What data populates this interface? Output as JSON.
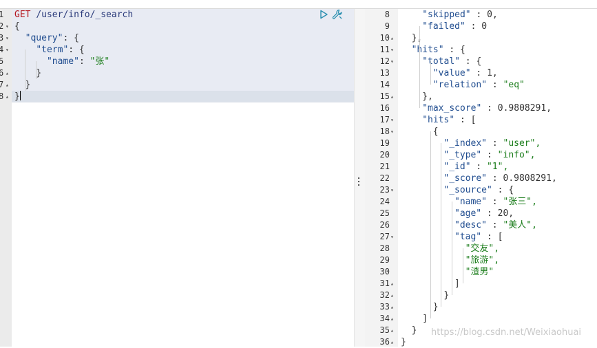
{
  "request_editor": {
    "line_numbers": [
      "1",
      "2",
      "3",
      "4",
      "5",
      "6",
      "7",
      "8"
    ],
    "method": "GET",
    "path": "/user/info/_search",
    "lines": {
      "l2": "{",
      "l3_key": "\"query\"",
      "l3_rest": ": {",
      "l4_key": "\"term\"",
      "l4_rest": ": {",
      "l5_key": "\"name\"",
      "l5_sep": ": ",
      "l5_val": "\"张\"",
      "l6": "}",
      "l7": "}",
      "l8": "}"
    }
  },
  "response_viewer": {
    "lines": [
      {
        "n": "8",
        "t": "\"skipped\" : 0,"
      },
      {
        "n": "9",
        "t": "\"failed\" : 0"
      },
      {
        "n": "10",
        "t": "},"
      },
      {
        "n": "11",
        "t": "\"hits\" : {"
      },
      {
        "n": "12",
        "t": "\"total\" : {"
      },
      {
        "n": "13",
        "t": "\"value\" : 1,"
      },
      {
        "n": "14",
        "t": "\"relation\" : \"eq\""
      },
      {
        "n": "15",
        "t": "},"
      },
      {
        "n": "16",
        "t": "\"max_score\" : 0.9808291,"
      },
      {
        "n": "17",
        "t": "\"hits\" : ["
      },
      {
        "n": "18",
        "t": "{"
      },
      {
        "n": "19",
        "t": "\"_index\" : \"user\","
      },
      {
        "n": "20",
        "t": "\"_type\" : \"info\","
      },
      {
        "n": "21",
        "t": "\"_id\" : \"1\","
      },
      {
        "n": "22",
        "t": "\"_score\" : 0.9808291,"
      },
      {
        "n": "23",
        "t": "\"_source\" : {"
      },
      {
        "n": "24",
        "t": "\"name\" : \"张三\","
      },
      {
        "n": "25",
        "t": "\"age\" : 20,"
      },
      {
        "n": "26",
        "t": "\"desc\" : \"美人\","
      },
      {
        "n": "27",
        "t": "\"tag\" : ["
      },
      {
        "n": "28",
        "t": "\"交友\","
      },
      {
        "n": "29",
        "t": "\"旅游\","
      },
      {
        "n": "30",
        "t": "\"渣男\""
      },
      {
        "n": "31",
        "t": "]"
      },
      {
        "n": "32",
        "t": "}"
      },
      {
        "n": "33",
        "t": "}"
      },
      {
        "n": "34",
        "t": "]"
      },
      {
        "n": "35",
        "t": "}"
      },
      {
        "n": "36",
        "t": "}"
      }
    ]
  },
  "watermark": "https://blog.csdn.net/Weixiaohuai",
  "icons": {
    "run": "play-icon",
    "settings": "wrench-icon",
    "resize": "drag-handle-icon"
  },
  "colors": {
    "method": "#b5161e",
    "string": "#1b7d1b",
    "key": "#1f4c8f",
    "active_line": "#dbe1ea"
  }
}
